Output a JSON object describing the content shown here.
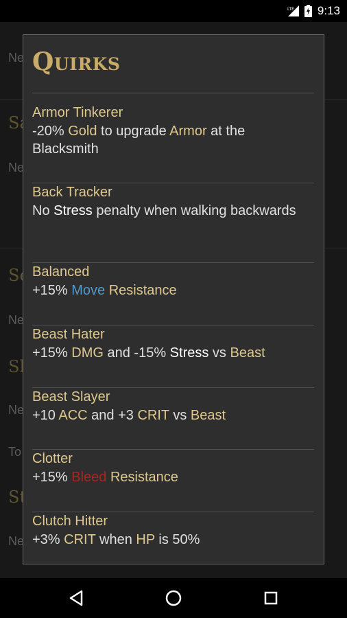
{
  "status_bar": {
    "time": "9:13",
    "network_label": "LTE"
  },
  "background": {
    "headers": [
      "Sa",
      "Se",
      "Sh",
      "St"
    ],
    "items": [
      "Ne",
      "Ne",
      "Ne",
      "Ne",
      "To",
      "Ne"
    ]
  },
  "dialog": {
    "title": "Quirks",
    "quirks": [
      {
        "name": "Armor Tinkerer",
        "desc": [
          {
            "t": "-20% "
          },
          {
            "t": "Gold",
            "c": "gold"
          },
          {
            "t": " to upgrade "
          },
          {
            "t": "Armor",
            "c": "gold"
          },
          {
            "t": " at the Blacksmith"
          }
        ]
      },
      {
        "name": "Back Tracker",
        "desc": [
          {
            "t": "No "
          },
          {
            "t": "Stress",
            "c": "white"
          },
          {
            "t": " penalty when walking backwards"
          }
        ]
      },
      {
        "name": "Balanced",
        "desc": [
          {
            "t": "+15% "
          },
          {
            "t": "Move",
            "c": "blue"
          },
          {
            "t": " Resistance",
            "c": "gold"
          }
        ]
      },
      {
        "name": "Beast Hater",
        "desc": [
          {
            "t": "+15% "
          },
          {
            "t": "DMG",
            "c": "gold"
          },
          {
            "t": " and -15% "
          },
          {
            "t": "Stress",
            "c": "white"
          },
          {
            "t": " vs "
          },
          {
            "t": "Beast",
            "c": "gold"
          }
        ]
      },
      {
        "name": "Beast Slayer",
        "desc": [
          {
            "t": "+10 "
          },
          {
            "t": "ACC",
            "c": "gold"
          },
          {
            "t": " and +3 "
          },
          {
            "t": "CRIT",
            "c": "gold"
          },
          {
            "t": " vs "
          },
          {
            "t": "Beast",
            "c": "gold"
          }
        ]
      },
      {
        "name": "Clotter",
        "desc": [
          {
            "t": "+15% "
          },
          {
            "t": "Bleed",
            "c": "red"
          },
          {
            "t": " Resistance",
            "c": "gold"
          }
        ]
      },
      {
        "name": "Clutch Hitter",
        "desc": [
          {
            "t": "+3% "
          },
          {
            "t": "CRIT",
            "c": "gold"
          },
          {
            "t": " when "
          },
          {
            "t": "HP",
            "c": "gold"
          },
          {
            "t": " is 50%"
          }
        ]
      }
    ]
  },
  "nav": {
    "back_icon": "back-triangle-icon",
    "home_icon": "home-circle-icon",
    "recents_icon": "recents-square-icon"
  },
  "colors": {
    "accent_gold": "#dec88e",
    "title_gold": "#c9ac6a",
    "move_blue": "#4f9bd0",
    "bleed_red": "#b0221e"
  }
}
